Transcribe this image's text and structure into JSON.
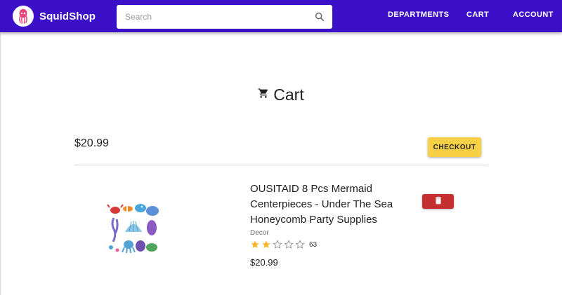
{
  "header": {
    "brand": "SquidShop",
    "search_placeholder": "Search",
    "nav": [
      "DEPARTMENTS",
      "CART",
      "ACCOUNT"
    ],
    "background_color": "#3c10c8",
    "logo_icon": "squid-logo-icon"
  },
  "cart": {
    "title": "Cart",
    "title_icon": "shopping-cart-icon",
    "total": "$20.99",
    "checkout_label": "CHECKOUT",
    "checkout_color": "#f7d046"
  },
  "items": [
    {
      "title": "OUSITAID 8 Pcs Mermaid Centerpieces - Under The Sea Honeycomb Party Supplies",
      "category": "Decor",
      "rating": 2,
      "max_rating": 5,
      "review_count": "63",
      "price": "$20.99",
      "delete_icon": "trash-icon",
      "delete_color": "#c62f2f"
    }
  ]
}
